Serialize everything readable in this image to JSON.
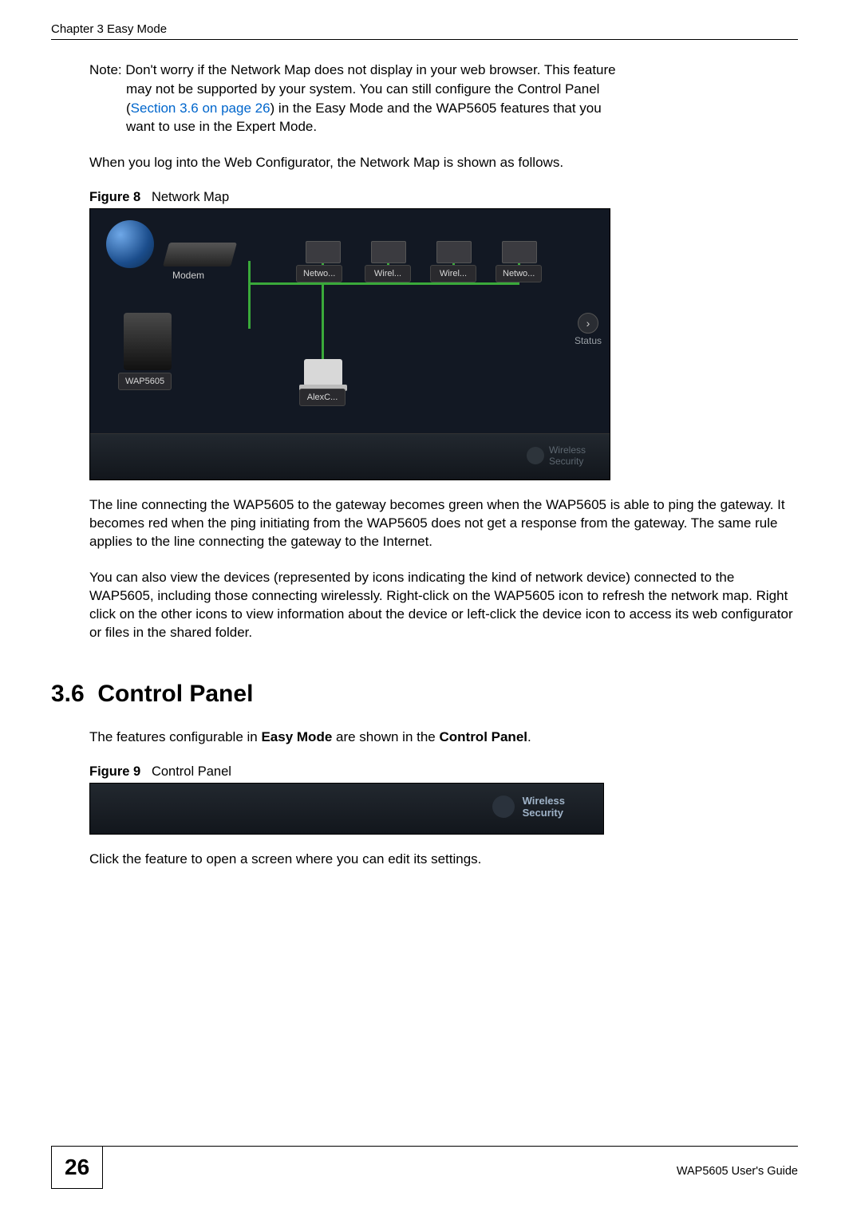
{
  "header": {
    "chapter": "Chapter 3 Easy Mode"
  },
  "note": {
    "prefix": "Note: ",
    "line1": "Don't worry if the Network Map does not display in your web browser. This feature",
    "line2": "may not be supported by your system. You can still configure the Control Panel",
    "line3_pre": "(",
    "line3_link": "Section 3.6 on page 26",
    "line3_post": ") in the Easy Mode and the WAP5605 features that you",
    "line4": "want to use in the Expert Mode."
  },
  "para_intro": "When you log into the Web Configurator, the Network Map is shown as follows.",
  "figure8": {
    "label": "Figure 8",
    "title": "Network Map",
    "modem_label": "Modem",
    "wap_label": "WAP5605",
    "devices": [
      "Netwo...",
      "Wirel...",
      "Wirel...",
      "Netwo..."
    ],
    "laptop_label": "AlexC...",
    "status_label": "Status",
    "wireless_security": "Wireless\nSecurity"
  },
  "para_after_fig8_1": "The line connecting the WAP5605 to the gateway becomes green when the WAP5605 is able to ping the gateway. It becomes red when the ping initiating from the WAP5605 does not get a response from the gateway. The same rule applies to the line connecting the gateway to the Internet.",
  "para_after_fig8_2": "You can also view the devices (represented by icons indicating the kind of network device) connected to the WAP5605, including those connecting wirelessly. Right-click on the WAP5605 icon to refresh the network map. Right click on the other icons to view information about the device or left-click the device icon to access its web configurator or files in the shared folder.",
  "section36": {
    "number": "3.6",
    "title": "Control Panel"
  },
  "para_cp_intro_pre": "The features configurable in ",
  "para_cp_intro_bold1": "Easy Mode",
  "para_cp_intro_mid": " are shown in the ",
  "para_cp_intro_bold2": "Control Panel",
  "para_cp_intro_post": ".",
  "figure9": {
    "label": "Figure 9",
    "title": "Control Panel",
    "wireless_line1": "Wireless",
    "wireless_line2": "Security"
  },
  "para_cp_after": "Click the feature to open a screen where you can edit its settings.",
  "footer": {
    "page_number": "26",
    "guide": "WAP5605 User's Guide"
  }
}
